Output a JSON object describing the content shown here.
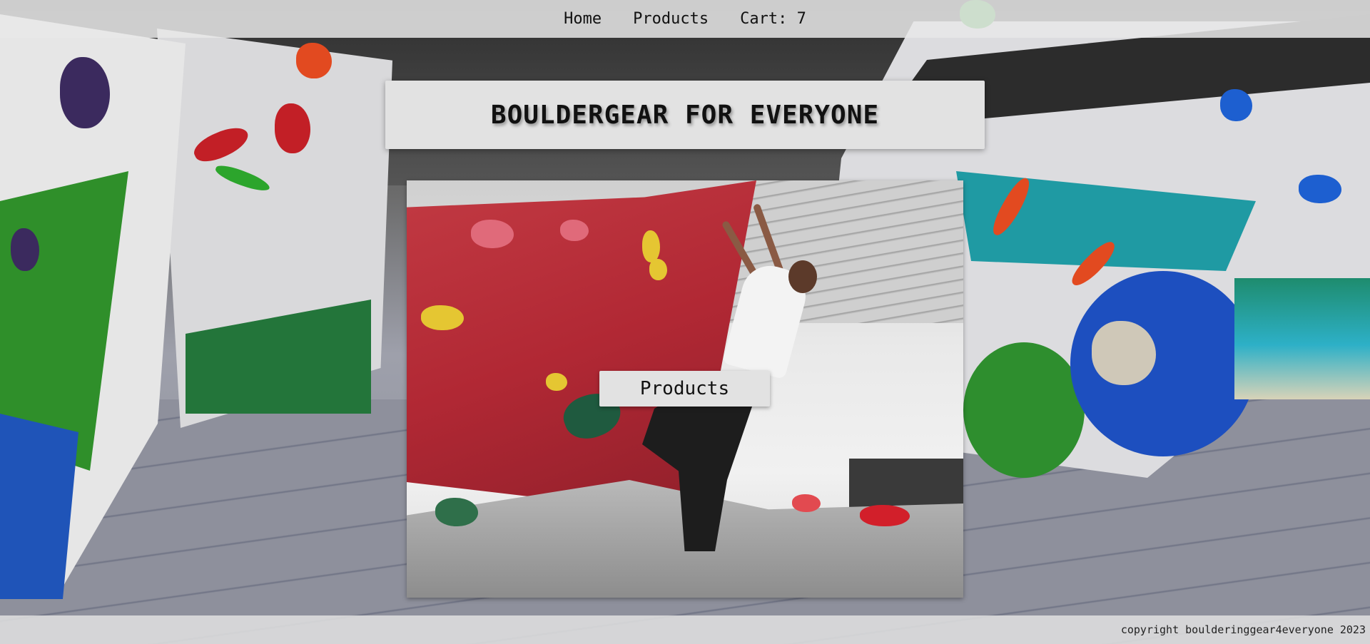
{
  "nav": {
    "items": [
      {
        "label": "Home"
      },
      {
        "label": "Products"
      },
      {
        "label": "Cart: 7"
      }
    ]
  },
  "hero": {
    "title": "BOULDERGEAR FOR EVERYONE",
    "products_button": "Products"
  },
  "footer": {
    "copyright": "copyright boulderinggear4everyone 2023"
  },
  "colors": {
    "bar_bg": "#e8e8e8",
    "banner_bg": "#e2e2e2",
    "text": "#111111"
  }
}
